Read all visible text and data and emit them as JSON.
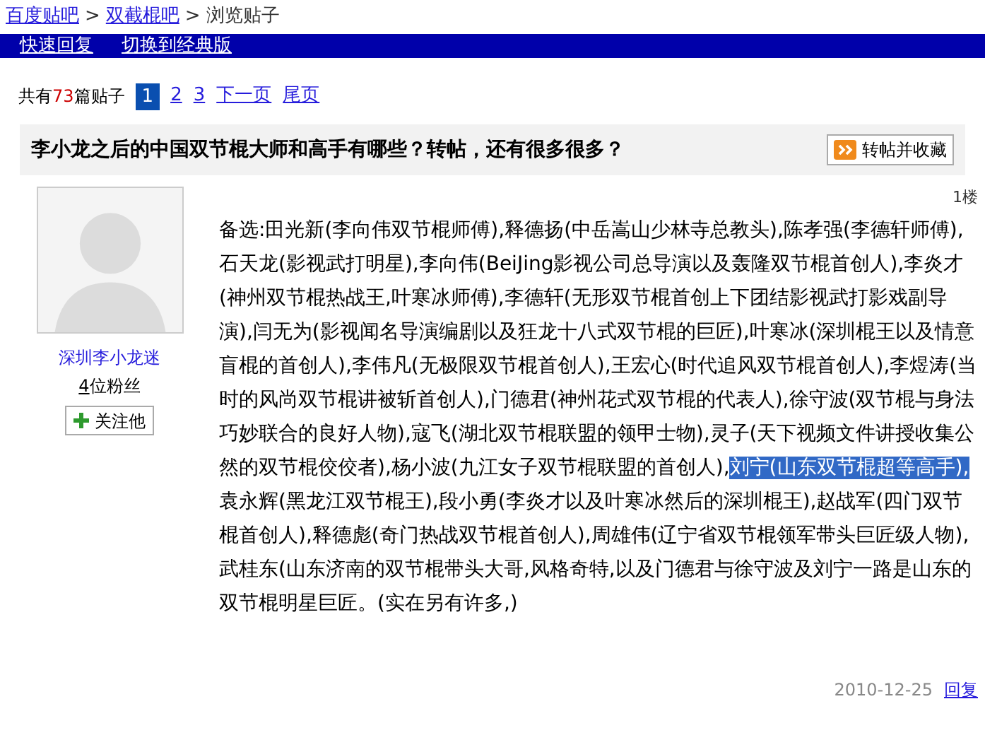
{
  "breadcrumb": [
    {
      "label": "百度贴吧",
      "link": true
    },
    {
      "label": ">",
      "link": false
    },
    {
      "label": "双截棍吧",
      "link": true
    },
    {
      "label": ">",
      "link": false
    },
    {
      "label": "浏览贴子",
      "link": false
    }
  ],
  "nav_bar": [
    "快速回复",
    "切换到经典版"
  ],
  "pager": {
    "prefix": "共有",
    "count": "73",
    "suffix": "篇贴子",
    "pages": [
      {
        "label": "1",
        "selected": true
      },
      {
        "label": "2",
        "selected": false
      },
      {
        "label": "3",
        "selected": false
      },
      {
        "label": "下一页",
        "selected": false
      },
      {
        "label": "尾页",
        "selected": false
      }
    ]
  },
  "thread": {
    "title": "李小龙之后的中国双节棍大师和高手有哪些？转帖，还有很多很多？",
    "repost_button": "转帖并收藏"
  },
  "post": {
    "floor": "1楼",
    "author": {
      "name": "深圳李小龙迷",
      "fans_count": "4",
      "fans_label": "位粉丝",
      "follow_button": "关注他"
    },
    "body": [
      {
        "text": "备选:田光新(李向伟双节棍师傅),释德扬(中岳嵩山少林寺总教头),陈孝强(李德轩师傅),石天龙(影视武打明星),李向伟(BeiJing影视公司总导演以及轰隆双节棍首创人),李炎才(神州双节棍热战王,叶寒冰师傅),李德轩(无形双节棍首创上下团结影视武打影戏副导演),闫无为(影视闻名导演编剧以及狂龙十八式双节棍的巨匠),叶寒冰(深圳棍王以及情意盲棍的首创人),李伟凡(无极限双节棍首创人),王宏心(时代追风双节棍首创人),李煜涛(当时的风尚双节棍讲被斩首创人),门德君(神州花式双节棍的代表人),徐守波(双节棍与身法巧妙联合的良好人物),寇飞(湖北双节棍联盟的领甲士物),灵子(天下视频文件讲授收集公然的双节棍佼佼者),杨小波(九江女子双节棍联盟的首创人),",
        "selected": false
      },
      {
        "text": "刘宁(山东双节棍超等高手),",
        "selected": true
      },
      {
        "text": "袁永辉(黑龙江双节棍王),段小勇(李炎才以及叶寒冰然后的深圳棍王),赵战军(四门双节棍首创人),释德彪(奇门热战双节棍首创人),周雄伟(辽宁省双节棍领军带头巨匠级人物),武桂东(山东济南的双节棍带头大哥,风格奇特,以及门德君与徐守波及刘宁一路是山东的双节棍明星巨匠。(实在另有许多,)",
        "selected": false
      }
    ],
    "time": "2010-12-25",
    "reply_link": "回复"
  }
}
